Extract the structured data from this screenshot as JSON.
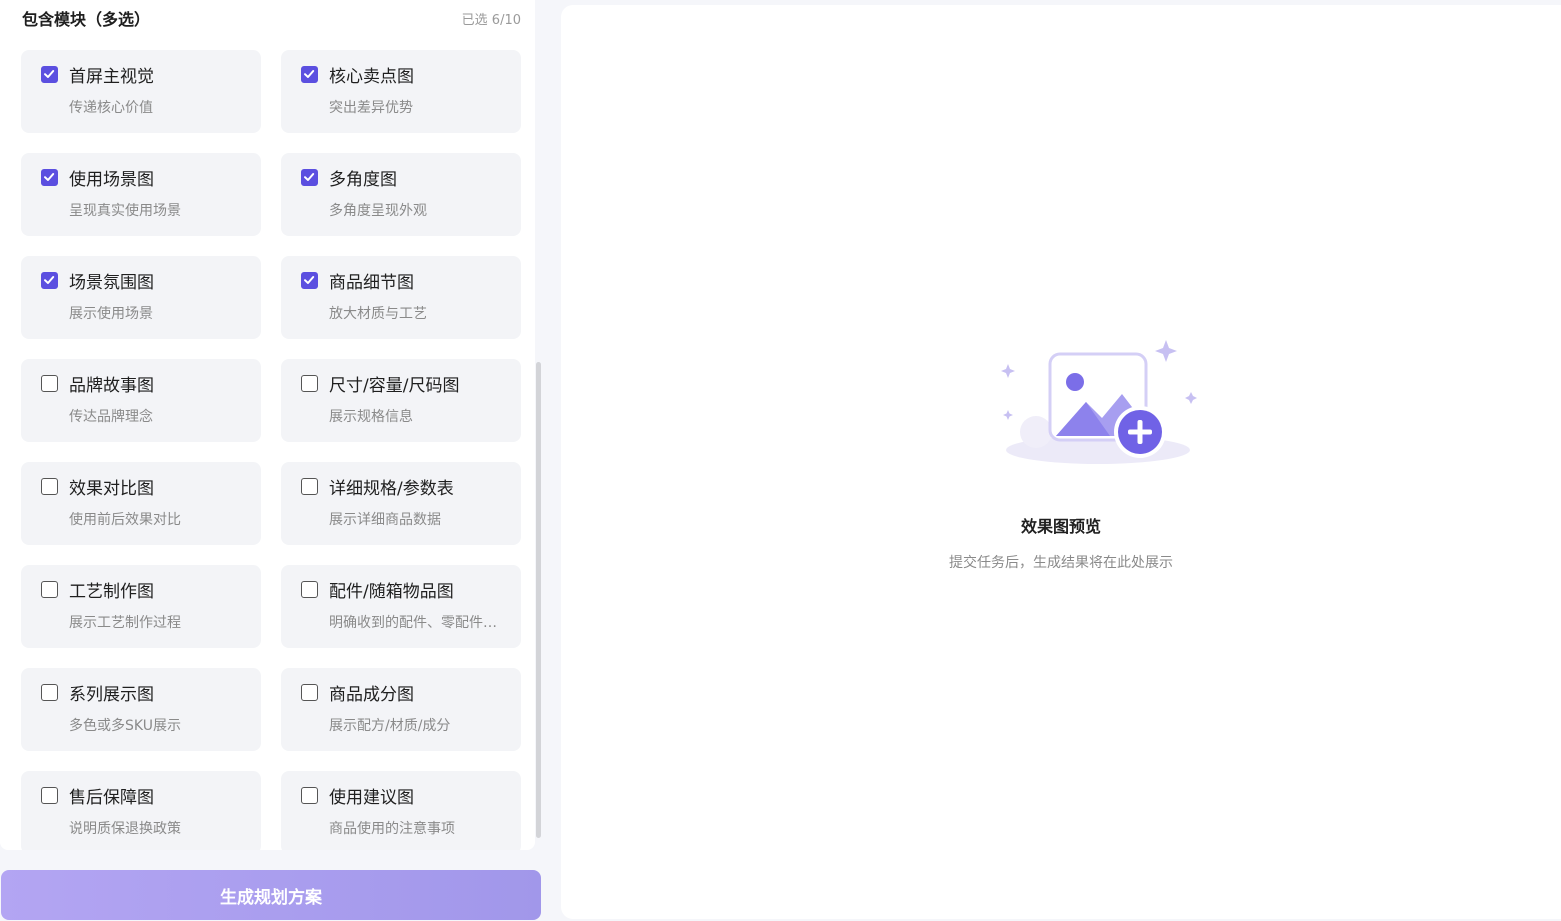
{
  "modules": {
    "section_title": "包含模块（多选）",
    "selected_count": "已选 6/10",
    "items": [
      {
        "title": "首屏主视觉",
        "desc": "传递核心价值",
        "checked": true
      },
      {
        "title": "核心卖点图",
        "desc": "突出差异优势",
        "checked": true
      },
      {
        "title": "使用场景图",
        "desc": "呈现真实使用场景",
        "checked": true
      },
      {
        "title": "多角度图",
        "desc": "多角度呈现外观",
        "checked": true
      },
      {
        "title": "场景氛围图",
        "desc": "展示使用场景",
        "checked": true
      },
      {
        "title": "商品细节图",
        "desc": "放大材质与工艺",
        "checked": true
      },
      {
        "title": "品牌故事图",
        "desc": "传达品牌理念",
        "checked": false
      },
      {
        "title": "尺寸/容量/尺码图",
        "desc": "展示规格信息",
        "checked": false
      },
      {
        "title": "效果对比图",
        "desc": "使用前后效果对比",
        "checked": false
      },
      {
        "title": "详细规格/参数表",
        "desc": "展示详细商品数据",
        "checked": false
      },
      {
        "title": "工艺制作图",
        "desc": "展示工艺制作过程",
        "checked": false
      },
      {
        "title": "配件/随箱物品图",
        "desc": "明确收到的配件、零配件…",
        "checked": false
      },
      {
        "title": "系列展示图",
        "desc": "多色或多SKU展示",
        "checked": false
      },
      {
        "title": "商品成分图",
        "desc": "展示配方/材质/成分",
        "checked": false
      },
      {
        "title": "售后保障图",
        "desc": "说明质保退换政策",
        "checked": false
      },
      {
        "title": "使用建议图",
        "desc": "商品使用的注意事项",
        "checked": false
      }
    ]
  },
  "actions": {
    "generate_label": "生成规划方案"
  },
  "preview": {
    "title": "效果图预览",
    "subtitle": "提交任务后，生成结果将在此处展示",
    "icon": "image-add-icon"
  },
  "colors": {
    "accent": "#5b4fe0",
    "button_gradient_start": "#b3a5f3",
    "button_gradient_end": "#a197ea"
  }
}
